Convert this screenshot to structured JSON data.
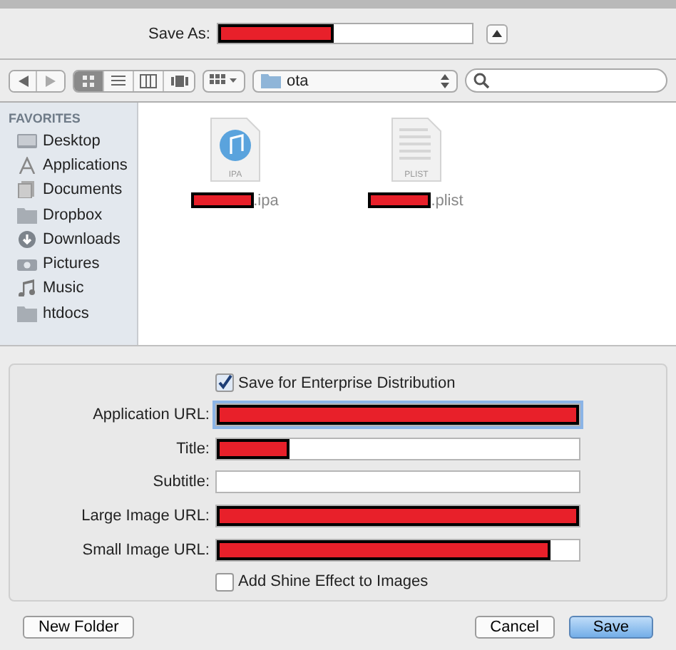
{
  "save_as": {
    "label": "Save As:",
    "redacted": true,
    "level": 0.45
  },
  "toolbar": {
    "view_modes": [
      {
        "kind": "icons",
        "selected": true
      },
      {
        "kind": "list",
        "selected": false
      },
      {
        "kind": "columns",
        "selected": false
      },
      {
        "kind": "coverflow",
        "selected": false
      }
    ],
    "location": "ota"
  },
  "sidebar": {
    "heading": "FAVORITES",
    "items": [
      {
        "label": "Desktop",
        "kind": "desktop"
      },
      {
        "label": "Applications",
        "kind": "apps"
      },
      {
        "label": "Documents",
        "kind": "docs"
      },
      {
        "label": "Dropbox",
        "kind": "folder"
      },
      {
        "label": "Downloads",
        "kind": "downloads"
      },
      {
        "label": "Pictures",
        "kind": "camera"
      },
      {
        "label": "Music",
        "kind": "music"
      },
      {
        "label": "htdocs",
        "kind": "folder"
      }
    ]
  },
  "files": [
    {
      "kind": "ipa",
      "badge": "IPA",
      "name": ".ipa",
      "redacted": true
    },
    {
      "kind": "plist",
      "badge": "PLIST",
      "name": ".plist",
      "redacted": true
    }
  ],
  "options": {
    "enterprise": {
      "label": "Save for Enterprise Distribution",
      "checked": true
    },
    "fields": [
      {
        "label": "Application URL:",
        "redacted": true,
        "level": 1,
        "focused": true
      },
      {
        "label": "Title:",
        "redacted": true,
        "level": 0.2,
        "focused": false
      },
      {
        "label": "Subtitle:",
        "redacted": false,
        "focused": false
      },
      {
        "label": "Large Image URL:",
        "redacted": true,
        "level": 1,
        "focused": false
      },
      {
        "label": "Small Image URL:",
        "redacted": true,
        "level": 0.92,
        "focused": false
      }
    ],
    "shine": {
      "label": "Add Shine Effect to Images",
      "checked": false
    }
  },
  "buttons": {
    "new_folder": "New Folder",
    "cancel": "Cancel",
    "save": "Save"
  }
}
